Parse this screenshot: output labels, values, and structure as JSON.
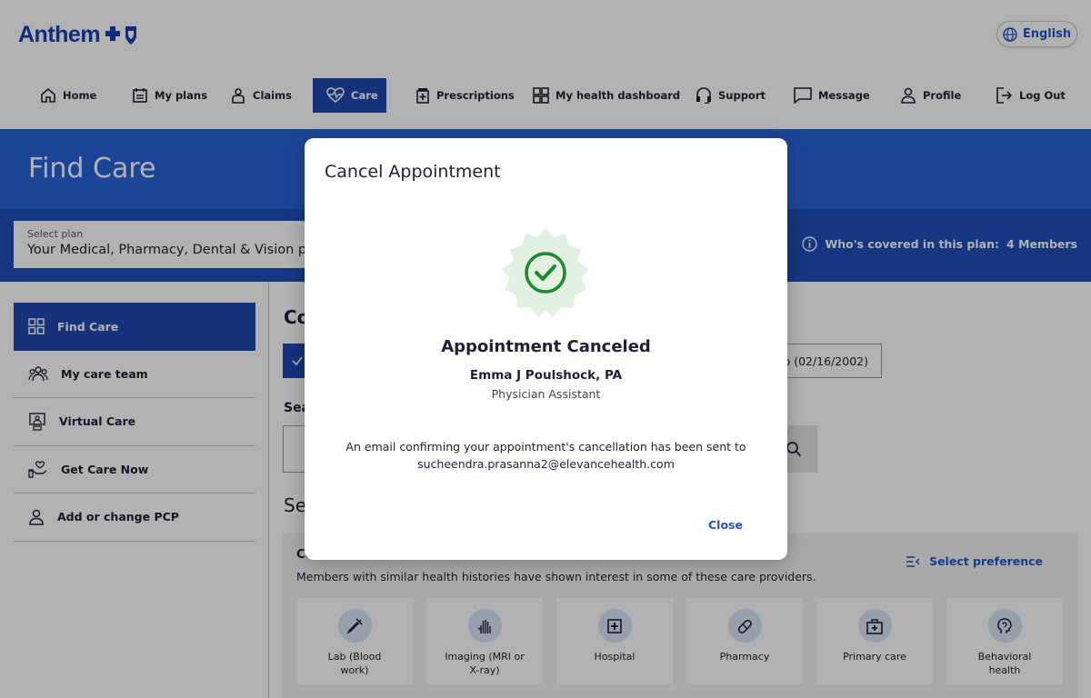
{
  "header": {
    "logo_text": "Anthem",
    "language_label": "English"
  },
  "nav": {
    "items": [
      {
        "label": "Home",
        "icon": "home-icon"
      },
      {
        "label": "My plans",
        "icon": "plans-icon"
      },
      {
        "label": "Claims",
        "icon": "claims-icon"
      },
      {
        "label": "Care",
        "icon": "heart-icon",
        "active": true
      },
      {
        "label": "Prescriptions",
        "icon": "prescription-icon"
      },
      {
        "label": "My health dashboard",
        "icon": "dashboard-icon"
      },
      {
        "label": "Support",
        "icon": "headset-icon"
      },
      {
        "label": "Message",
        "icon": "message-icon"
      },
      {
        "label": "Profile",
        "icon": "person-icon"
      },
      {
        "label": "Log Out",
        "icon": "logout-icon"
      }
    ]
  },
  "banner": {
    "title": "Find Care"
  },
  "plan": {
    "label": "Select plan",
    "value": "Your Medical, Pharmacy, Dental & Vision p",
    "covered_label": "Who's covered in this plan:",
    "covered_value": "4 Members"
  },
  "sidebar": {
    "items": [
      {
        "label": "Find Care",
        "icon": "grid-icon",
        "active": true
      },
      {
        "label": "My care team",
        "icon": "team-icon"
      },
      {
        "label": "Virtual Care",
        "icon": "virtual-care-icon"
      },
      {
        "label": "Get Care Now",
        "icon": "hand-heart-icon"
      },
      {
        "label": "Add or change PCP",
        "icon": "person-icon"
      }
    ]
  },
  "main": {
    "heading": "Co",
    "member_button": "ro (02/16/2002)",
    "search_label": "Sea",
    "section_title": "Se",
    "suggest_title": "Co",
    "suggest_desc": "Members with similar health histories have shown interest in some of these care providers.",
    "preference_label": "Select preference",
    "cards": [
      {
        "label": "Lab (Blood work)",
        "icon": "syringe-icon"
      },
      {
        "label": "Imaging (MRI or X-ray)",
        "icon": "xray-hand-icon"
      },
      {
        "label": "Hospital",
        "icon": "hospital-icon"
      },
      {
        "label": "Pharmacy",
        "icon": "pill-icon"
      },
      {
        "label": "Primary care",
        "icon": "medical-bag-icon"
      },
      {
        "label": "Behavioral health",
        "icon": "brain-head-icon"
      }
    ]
  },
  "modal": {
    "title": "Cancel Appointment",
    "heading": "Appointment Canceled",
    "provider_name": "Emma J Poulshock, PA",
    "provider_role": "Physician Assistant",
    "message": "An email confirming your appointment's cancellation has been sent to sucheendra.prasanna2@elevancehealth.com",
    "close_label": "Close"
  },
  "colors": {
    "brand_blue": "#1f48b0",
    "banner_blue": "#2a63d8",
    "link_blue": "#2453c7",
    "success_green": "#1e8a2e"
  }
}
